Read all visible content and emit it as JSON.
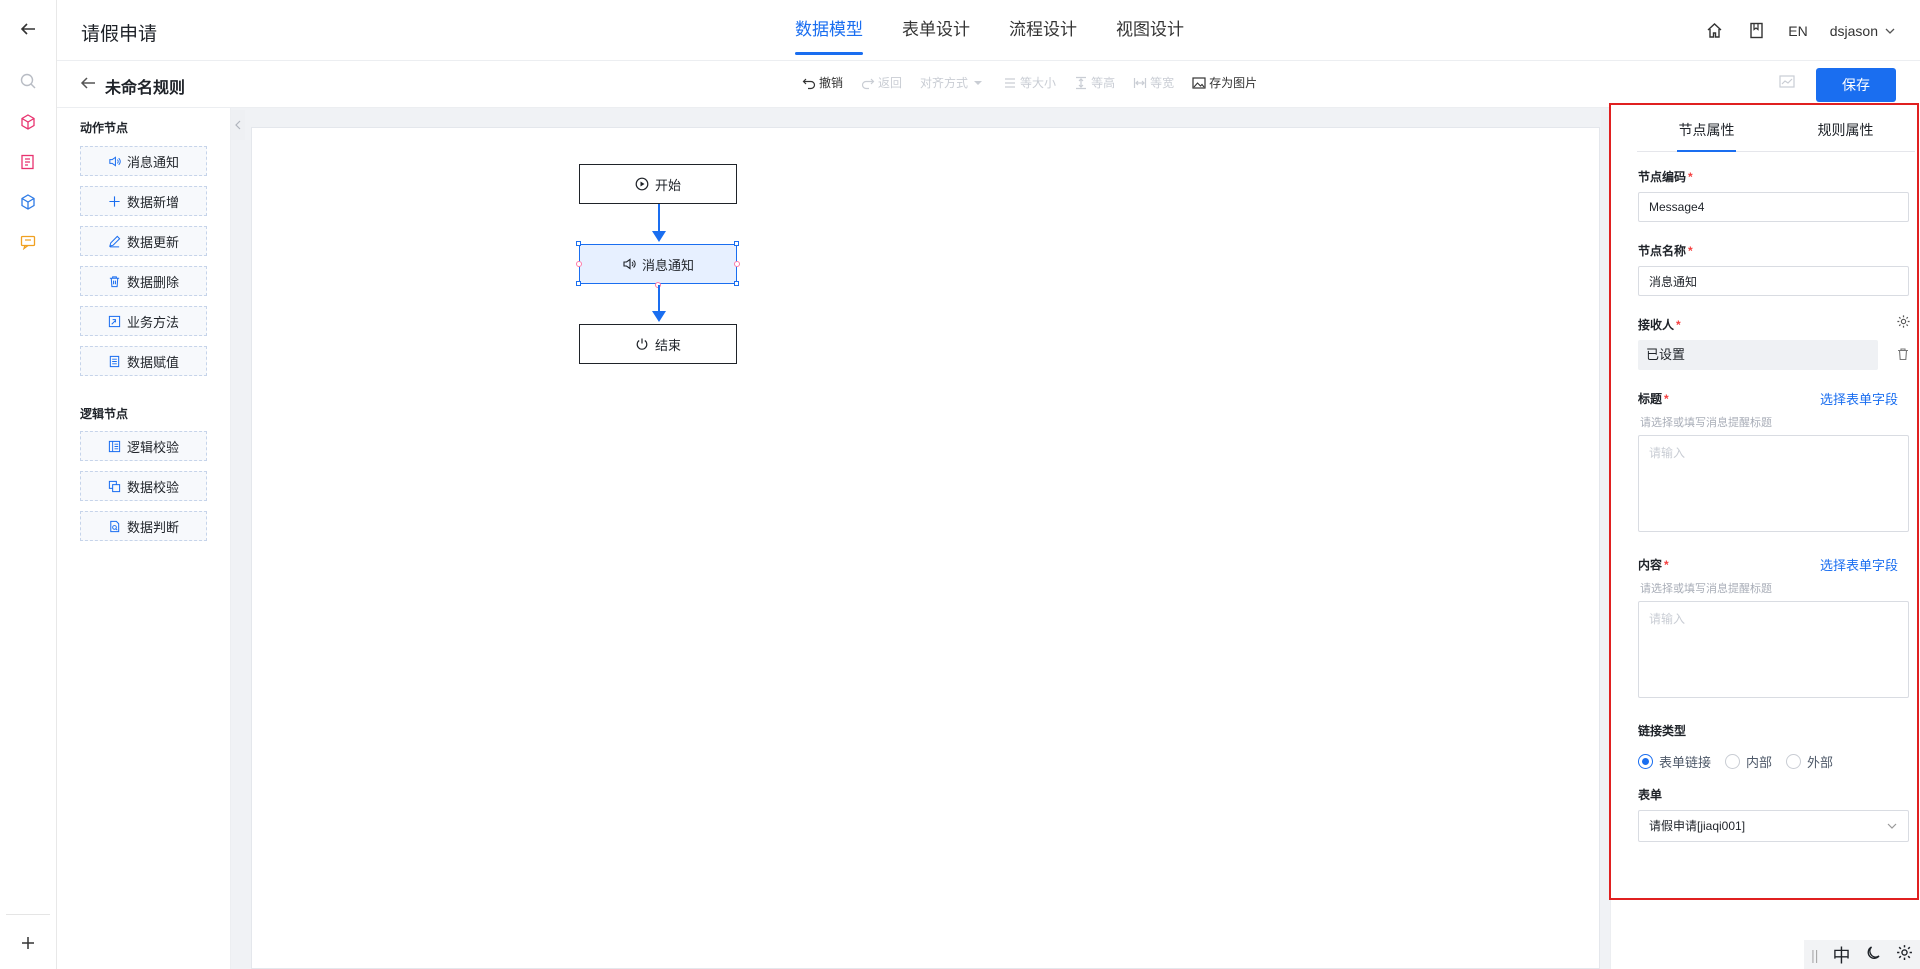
{
  "header": {
    "app_title": "请假申请",
    "tabs": [
      {
        "label": "数据模型",
        "active": true
      },
      {
        "label": "表单设计",
        "active": false
      },
      {
        "label": "流程设计",
        "active": false
      },
      {
        "label": "视图设计",
        "active": false
      }
    ],
    "lang": "EN",
    "user": "dsjason",
    "icons": [
      "home-icon",
      "book-icon",
      "chevron-down-icon"
    ]
  },
  "rail": {
    "icons": [
      "back-arrow-icon",
      "search-icon",
      "cube-icon",
      "form-icon",
      "box-icon",
      "chat-icon",
      "add-icon"
    ]
  },
  "toolbar": {
    "rule_name": "未命名规则",
    "tools": [
      {
        "label": "撤销",
        "enabled": true
      },
      {
        "label": "返回",
        "enabled": false
      },
      {
        "label": "对齐方式",
        "enabled": false
      },
      {
        "label": "等大小",
        "enabled": false
      },
      {
        "label": "等高",
        "enabled": false
      },
      {
        "label": "等宽",
        "enabled": false
      },
      {
        "label": "存为图片",
        "enabled": true
      }
    ],
    "save_label": "保存"
  },
  "palette": {
    "action_title": "动作节点",
    "action_nodes": [
      "消息通知",
      "数据新增",
      "数据更新",
      "数据删除",
      "业务方法",
      "数据赋值"
    ],
    "logic_title": "逻辑节点",
    "logic_nodes": [
      "逻辑校验",
      "数据校验",
      "数据判断"
    ]
  },
  "flow": {
    "start": "开始",
    "message": "消息通知",
    "end": "结束"
  },
  "panel": {
    "tabs": [
      "节点属性",
      "规则属性"
    ],
    "active_tab": "节点属性",
    "node_code_label": "节点编码",
    "node_code_value": "Message4",
    "node_name_label": "节点名称",
    "node_name_value": "消息通知",
    "receiver_label": "接收人",
    "receiver_value": "已设置",
    "title_label": "标题",
    "title_link": "选择表单字段",
    "title_hint": "请选择或填写消息提醒标题",
    "title_placeholder": "请输入",
    "content_label": "内容",
    "content_link": "选择表单字段",
    "content_hint": "请选择或填写消息提醒标题",
    "content_placeholder": "请输入",
    "link_type_label": "链接类型",
    "link_types": [
      "表单链接",
      "内部",
      "外部"
    ],
    "link_type_selected": "表单链接",
    "form_label": "表单",
    "form_value": "请假申请[jiaqi001]"
  },
  "widget": {
    "lang_char": "中"
  },
  "colors": {
    "accent": "#1a6ef0",
    "required": "#f53f3f",
    "highlight_border": "#e02020"
  }
}
